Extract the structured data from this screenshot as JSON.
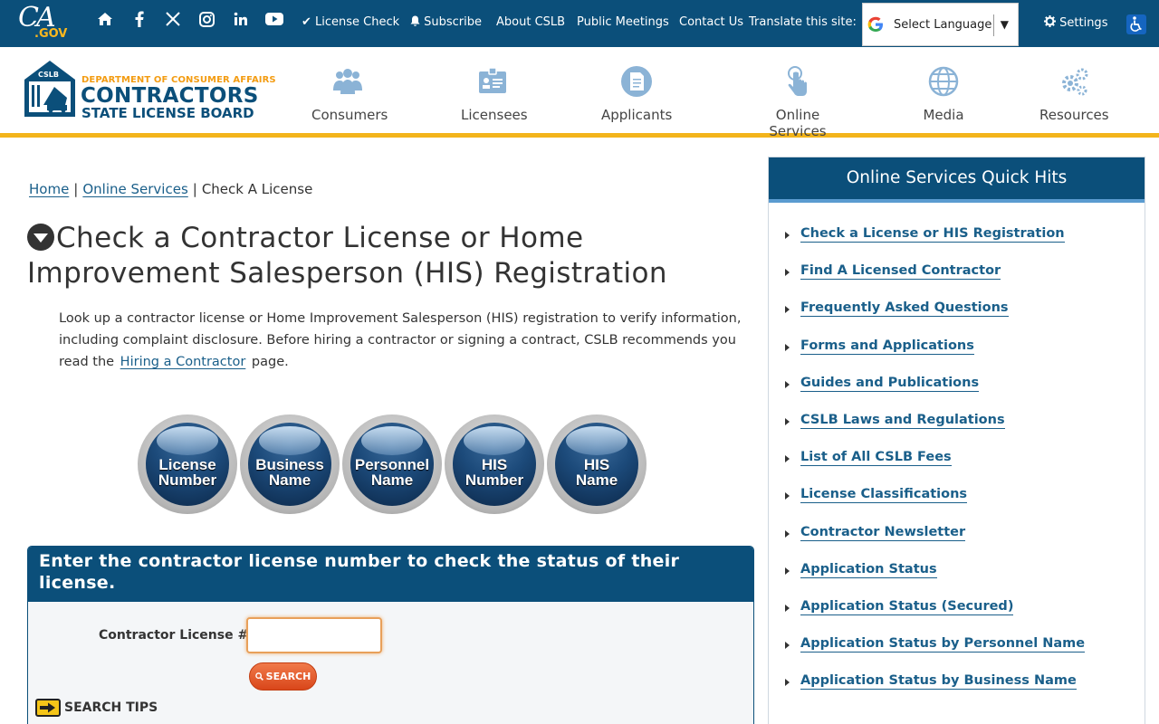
{
  "topbar": {
    "logo": {
      "main": "CA",
      "sub": ".GOV"
    },
    "social_icons": [
      "home-icon",
      "facebook-icon",
      "x-twitter-icon",
      "instagram-icon",
      "linkedin-icon",
      "youtube-icon"
    ],
    "links": {
      "license_check": "✔ License Check",
      "subscribe": "Subscribe",
      "about": "About CSLB",
      "meetings": "Public Meetings",
      "contact": "Contact Us",
      "translate": "Translate this site:",
      "settings": "Settings"
    },
    "language_select": {
      "value": "Select Language",
      "arrow": "▼"
    },
    "colors": {
      "bar": "#0b4f7a",
      "accent": "#fdb81e"
    }
  },
  "header": {
    "logo": {
      "dept": "DEPARTMENT OF CONSUMER AFFAIRS",
      "title": "CONTRACTORS",
      "subtitle": "STATE LICENSE BOARD",
      "badge": "CSLB"
    },
    "nav": [
      {
        "label": "Consumers",
        "icon": "people-icon"
      },
      {
        "label": "Licensees",
        "icon": "license-card-icon"
      },
      {
        "label": "Applicants",
        "icon": "document-icon"
      },
      {
        "label": "Online Services",
        "icon": "pointer-hand-icon"
      },
      {
        "label": "Media",
        "icon": "globe-icon"
      },
      {
        "label": "Resources",
        "icon": "gears-icon"
      }
    ],
    "accent_color": "#f3b41b"
  },
  "breadcrumb": {
    "home": "Home",
    "section": "Online Services",
    "current": "Check A License",
    "sep": "|"
  },
  "main": {
    "title": "Check a Contractor License or Home Improvement Salesperson (HIS) Registration",
    "intro_text": "Look up a contractor license or Home Improvement Salesperson (HIS) registration to verify information, including complaint disclosure. Before hiring a contractor or signing a contract, CSLB recommends you read the",
    "intro_link": "Hiring a Contractor",
    "intro_end": "page.",
    "search_types": [
      {
        "line1": "License",
        "line2": "Number"
      },
      {
        "line1": "Business",
        "line2": "Name"
      },
      {
        "line1": "Personnel",
        "line2": "Name"
      },
      {
        "line1": "HIS",
        "line2": "Number"
      },
      {
        "line1": "HIS",
        "line2": "Name"
      }
    ],
    "search_panel": {
      "heading": "Enter the contractor license number to check the status of their license.",
      "field_label": "Contractor License #",
      "field_value": "",
      "search_button": "SEARCH",
      "tips_label": "SEARCH TIPS"
    }
  },
  "sidebar": {
    "title": "Online Services Quick Hits",
    "items": [
      "Check a License or HIS Registration",
      "Find A Licensed Contractor",
      "Frequently Asked Questions",
      "Forms and Applications",
      "Guides and Publications",
      "CSLB Laws and Regulations",
      "List of All CSLB Fees",
      "License Classifications",
      "Contractor Newsletter",
      "Application Status",
      "Application Status (Secured)",
      "Application Status by Personnel Name",
      "Application Status by Business Name"
    ]
  }
}
